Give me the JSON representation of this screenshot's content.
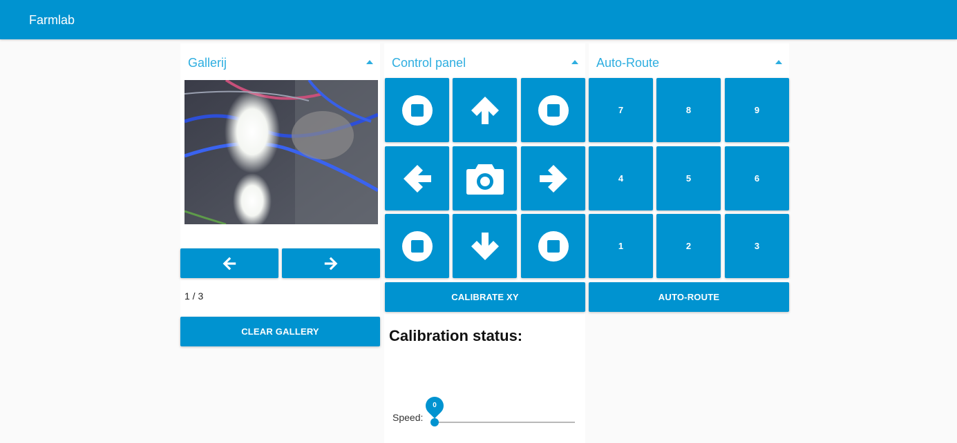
{
  "app": {
    "title": "Farmlab"
  },
  "gallery": {
    "title": "Gallerij",
    "prev_icon": "arrow-left-icon",
    "next_icon": "arrow-right-icon",
    "counter": "1 / 3",
    "clear_label": "CLEAR GALLERY"
  },
  "control": {
    "title": "Control panel",
    "buttons": [
      {
        "icon": "stop-icon"
      },
      {
        "icon": "arrow-up-icon"
      },
      {
        "icon": "stop-icon"
      },
      {
        "icon": "arrow-left-icon"
      },
      {
        "icon": "camera-icon"
      },
      {
        "icon": "arrow-right-icon"
      },
      {
        "icon": "stop-icon"
      },
      {
        "icon": "arrow-down-icon"
      },
      {
        "icon": "stop-icon"
      }
    ],
    "calibrate_label": "CALIBRATE XY",
    "calibration_status_label": "Calibration status:",
    "speed_label": "Speed:",
    "speed_value": "0"
  },
  "autoroute": {
    "title": "Auto-Route",
    "keys": [
      "7",
      "8",
      "9",
      "4",
      "5",
      "6",
      "1",
      "2",
      "3"
    ],
    "button_label": "AUTO-ROUTE"
  },
  "colors": {
    "primary": "#0093d0",
    "accent_text": "#2eaee0",
    "background": "#fafafa"
  }
}
